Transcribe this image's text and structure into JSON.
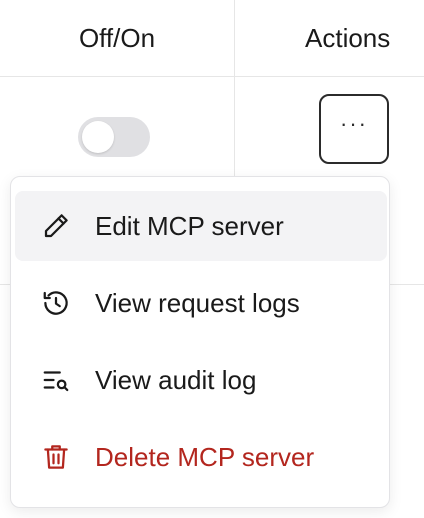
{
  "table": {
    "columns": [
      "Off/On",
      "Actions"
    ],
    "row": {
      "toggle_on": false,
      "actions_label": "···"
    }
  },
  "menu": {
    "items": [
      {
        "label": "Edit MCP server",
        "icon": "pencil-icon",
        "state": "hover"
      },
      {
        "label": "View request logs",
        "icon": "history-icon"
      },
      {
        "label": "View audit log",
        "icon": "list-search-icon"
      },
      {
        "label": "Delete MCP server",
        "icon": "trash-icon",
        "variant": "danger"
      }
    ]
  },
  "colors": {
    "danger": "#b3261e",
    "hover_bg": "#f3f3f5",
    "toggle_off": "#e0e0e3"
  }
}
